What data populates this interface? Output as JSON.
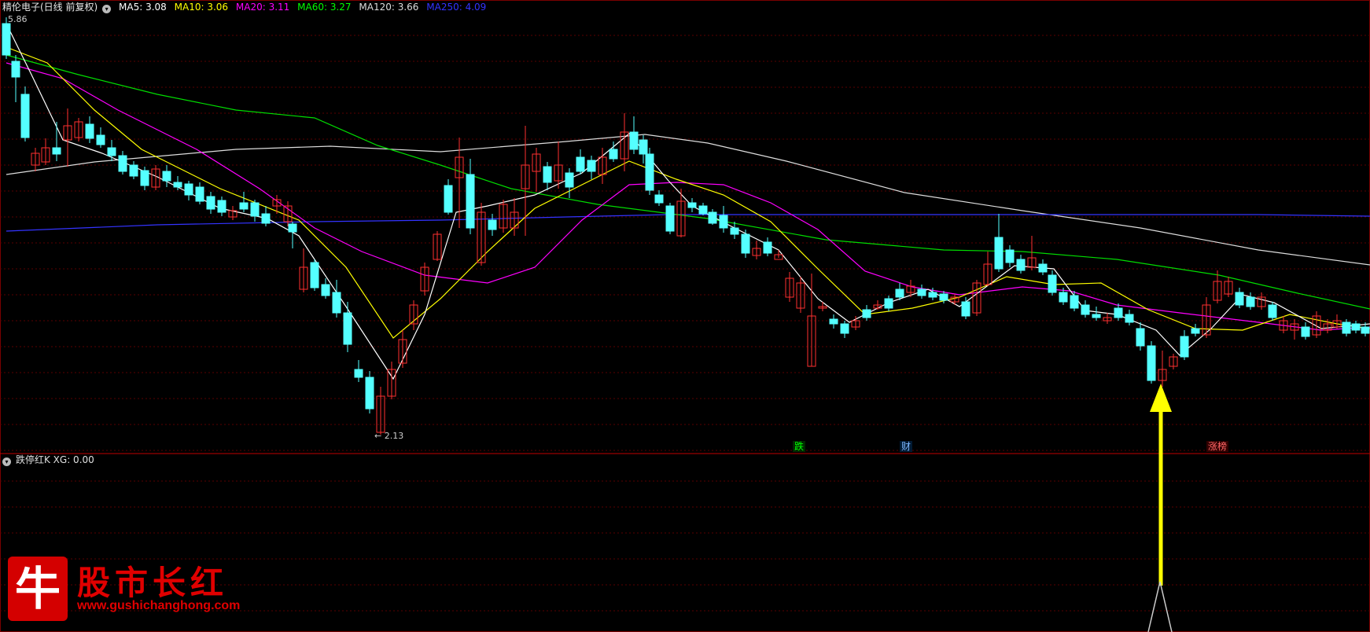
{
  "header": {
    "stock": "精伦电子(日线 前复权)",
    "indicators": [
      {
        "label": "MA5: 3.08",
        "color": "#ffffff"
      },
      {
        "label": "MA10: 3.06",
        "color": "#ffff00"
      },
      {
        "label": "MA20: 3.11",
        "color": "#ff00ff"
      },
      {
        "label": "MA60: 3.27",
        "color": "#00ff00"
      },
      {
        "label": "MA120: 3.66",
        "color": "#dddddd"
      },
      {
        "label": "MA250: 4.09",
        "color": "#3333ff"
      }
    ]
  },
  "lower_panel": {
    "title": "跌停红K XG: 0.00"
  },
  "price_labels": {
    "high": "5.86",
    "low": "2.13"
  },
  "markers": [
    {
      "text": "跌",
      "color": "#00ff00",
      "bg": "#003300"
    },
    {
      "text": "财",
      "color": "#7fb8ff",
      "bg": "#001a33"
    },
    {
      "text": "涨榜",
      "color": "#ff6666",
      "bg": "#330000"
    }
  ],
  "watermark": {
    "icon": "牛",
    "title": "股市长红",
    "url": "www.gushichanghong.com"
  },
  "colors": {
    "up": "#ff3030",
    "down": "#54ffff",
    "grid": "#7a0000",
    "arrow": "#ffff00"
  }
}
